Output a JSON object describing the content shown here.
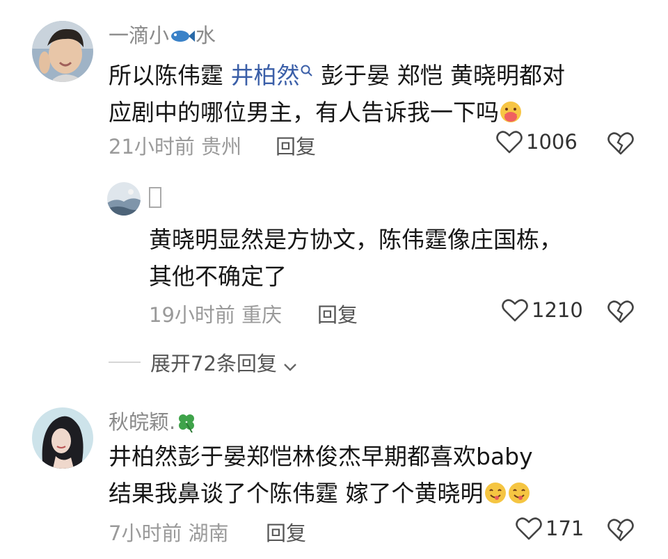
{
  "comments": [
    {
      "author": "一滴小",
      "author_suffix": "水",
      "author_icon": "fish-icon",
      "line1_a": "所以陈伟霆 ",
      "line1_link": "井柏然",
      "line1_b": " 彭于晏 郑恺 黄晓明都对",
      "line2": "应剧中的哪位男主，有人告诉我一下吗",
      "time": "21小时前",
      "location": "贵州",
      "reply_label": "回复",
      "likes": "1006"
    },
    {
      "author": "",
      "line1": "黄晓明显然是方协文，陈伟霆像庄国栋，",
      "line2": "其他不确定了",
      "time": "19小时前",
      "location": "重庆",
      "reply_label": "回复",
      "likes": "1210"
    },
    {
      "author": "秋皖颖.",
      "author_icon": "clover-icon",
      "line1": "井柏然彭于晏郑恺林俊杰早期都喜欢baby",
      "line2": "结果我鼻谈了个陈伟霆 嫁了个黄晓明",
      "time": "7小时前",
      "location": "湖南",
      "reply_label": "回复",
      "likes": "171"
    }
  ],
  "expand_replies": "展开72条回复",
  "colors": {
    "link": "#3b5fa8",
    "muted": "#9a9a9a",
    "text": "#161616"
  }
}
